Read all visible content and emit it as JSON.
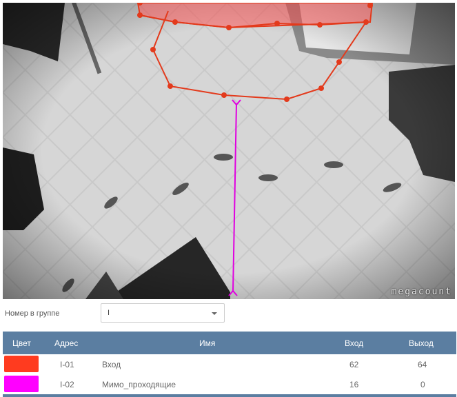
{
  "camera": {
    "watermark": "megacount"
  },
  "filter": {
    "label": "Номер в группе",
    "value": "I"
  },
  "table": {
    "headers": {
      "color": "Цвет",
      "address": "Адрес",
      "name": "Имя",
      "in": "Вход",
      "out": "Выход"
    },
    "rows": [
      {
        "color": "#ff3b1f",
        "address": "I-01",
        "name": "Вход",
        "in": "62",
        "out": "64"
      },
      {
        "color": "#ff00ff",
        "address": "I-02",
        "name": "Мимо_проходящие",
        "in": "16",
        "out": "0"
      }
    ]
  },
  "colors": {
    "zone": "#e33a1c",
    "line": "#e000e0",
    "header": "#5b7ea1"
  }
}
